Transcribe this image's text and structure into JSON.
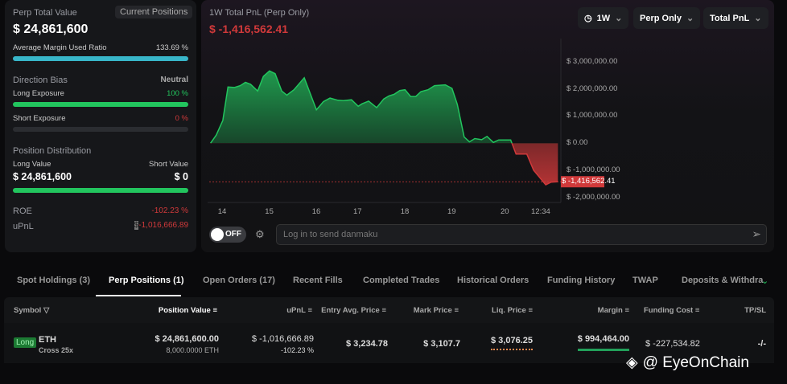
{
  "summary": {
    "title": "Perp Total Value",
    "current_positions_btn": "Current Positions",
    "total_value": "$ 24,861,600",
    "margin_label": "Average Margin Used Ratio",
    "margin_value": "133.69 %",
    "margin_fraction": 1.0,
    "direction_label": "Direction Bias",
    "direction_value": "Neutral",
    "long_exposure_label": "Long Exposure",
    "long_exposure_value": "100 %",
    "long_exposure_fraction": 1.0,
    "short_exposure_label": "Short Exposure",
    "short_exposure_value": "0 %",
    "short_exposure_fraction": 0,
    "distribution_label": "Position Distribution",
    "long_value_label": "Long Value",
    "short_value_label": "Short Value",
    "long_value": "$ 24,861,600",
    "short_value": "$ 0",
    "long_share": 1.0,
    "roe_label": "ROE",
    "roe_value": "-102.23 %",
    "upnl_label": "uPnL",
    "upnl_currency": "$",
    "upnl_value": "-1,016,666.89"
  },
  "chart": {
    "title": "1W Total PnL (Perp Only)",
    "current_value": "$ -1,416,562.41",
    "filters": {
      "period": "1W",
      "scope": "Perp Only",
      "metric": "Total PnL"
    },
    "danmaku_toggle": "OFF",
    "danmaku_placeholder": "Log in to send danmaku"
  },
  "chart_data": {
    "type": "area",
    "title": "1W Total PnL (Perp Only)",
    "ylim": [
      -2300000,
      3500000
    ],
    "y_ticks": [
      "$ 3,000,000.00",
      "$ 2,000,000.00",
      "$ 1,000,000.00",
      "$ 0.00",
      "$ -1,000,000.00",
      "$ -2,000,000.00"
    ],
    "y_tick_values": [
      3000000,
      2000000,
      1000000,
      0,
      -1000000,
      -2000000
    ],
    "x_ticks": [
      "14",
      "15",
      "16",
      "17",
      "18",
      "19",
      "20",
      "12:34"
    ],
    "x_tick_days": [
      14,
      15,
      16,
      17,
      18,
      19,
      20,
      20.524
    ],
    "last_value_label": "$ -1,416,562.41",
    "last_value": -1416562.41,
    "colors": {
      "positive": "#22c55e",
      "negative": "#d0393a"
    },
    "x": [
      13.76,
      13.88,
      14.02,
      14.13,
      14.27,
      14.39,
      14.5,
      14.61,
      14.76,
      14.88,
      15.01,
      15.13,
      15.27,
      15.38,
      15.53,
      15.75,
      16.01,
      16.18,
      16.34,
      16.53,
      16.66,
      16.86,
      17.02,
      17.1,
      17.24,
      17.36,
      17.41,
      17.56,
      17.67,
      17.78,
      17.9,
      18.01,
      18.13,
      18.24,
      18.35,
      18.5,
      18.64,
      18.87,
      19.01,
      19.11,
      19.24,
      19.34,
      19.44,
      19.57,
      19.67,
      19.79,
      19.89,
      20.09,
      20.17,
      20.33,
      20.43,
      20.61,
      20.69,
      20.79
    ],
    "y": [
      0,
      300000,
      840000,
      2070000,
      2050000,
      2120000,
      2240000,
      2170000,
      1920000,
      2460000,
      2660000,
      2560000,
      1920000,
      1770000,
      1970000,
      2410000,
      1230000,
      1530000,
      1660000,
      1580000,
      1570000,
      1600000,
      1360000,
      1450000,
      1550000,
      1380000,
      1310000,
      1630000,
      1740000,
      1800000,
      1940000,
      1970000,
      1720000,
      1720000,
      1900000,
      1970000,
      2120000,
      2150000,
      2020000,
      1430000,
      230000,
      50000,
      170000,
      130000,
      250000,
      30000,
      120000,
      120000,
      -400000,
      -400000,
      -990000,
      -1530000,
      -1430000,
      -1416562
    ]
  },
  "tabs": [
    "Spot Holdings (3)",
    "Perp Positions (1)",
    "Open Orders (17)",
    "Recent Fills",
    "Completed Trades",
    "Historical Orders",
    "Funding History",
    "TWAP",
    "Deposits & Withdra"
  ],
  "active_tab": 1,
  "table": {
    "headers": [
      "Symbol",
      "Position Value",
      "uPnL",
      "Entry Avg. Price",
      "Mark Price",
      "Liq. Price",
      "Margin",
      "Funding Cost",
      "TP/SL"
    ],
    "rows": [
      {
        "side": "Long",
        "symbol": "ETH",
        "mode": "Cross 25x",
        "position_value": "$ 24,861,600.00",
        "size": "8,000.0000 ETH",
        "upnl": "$ -1,016,666.89",
        "upnl_pct": "-102.23 %",
        "entry": "$ 3,234.78",
        "mark": "$ 3,107.7",
        "liq": "$ 3,076.25",
        "margin": "$ 994,464.00",
        "funding": "$ -227,534.82",
        "tpsl": "-/-"
      }
    ]
  },
  "watermark": "@ EyeOnChain"
}
